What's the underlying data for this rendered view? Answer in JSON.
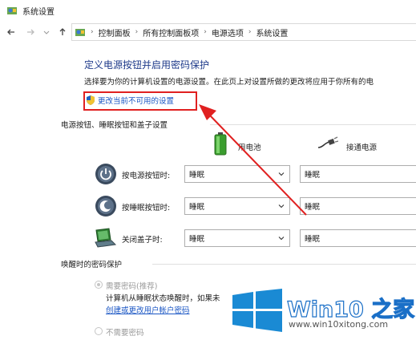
{
  "window": {
    "title": "系统设置"
  },
  "address_bar": {
    "crumbs": [
      "控制面板",
      "所有控制面板项",
      "电源选项",
      "系统设置"
    ]
  },
  "main": {
    "heading": "定义电源按钮并启用密码保护",
    "description": "选择要为你的计算机设置的电源设置。在此页上对设置所做的更改将应用于你所有的电",
    "change_link": "更改当前不可用的设置"
  },
  "buttons_section": {
    "title": "电源按钮、睡眠按钮和盖子设置",
    "col_battery": "用电池",
    "col_plugged": "接通电源",
    "rows": [
      {
        "label": "按电源按钮时:",
        "battery": "睡眠",
        "plugged": "睡眠"
      },
      {
        "label": "按睡眠按钮时:",
        "battery": "睡眠",
        "plugged": "睡眠"
      },
      {
        "label": "关闭盖子时:",
        "battery": "睡眠",
        "plugged": "睡眠"
      }
    ]
  },
  "wake_section": {
    "title": "唤醒时的密码保护",
    "option_require": "需要密码(推荐)",
    "require_desc": "计算机从睡眠状态唤醒时，如果未",
    "require_link": "创建或更改用户帐户密码",
    "option_none": "不需要密码"
  },
  "watermark": {
    "brand": "Win10 之家",
    "url": "www.win10xitong.com"
  },
  "colors": {
    "heading": "#1e3a8a",
    "link": "#1a56c4",
    "highlight": "#e02020",
    "brand_blue": "#1a6fc7"
  }
}
